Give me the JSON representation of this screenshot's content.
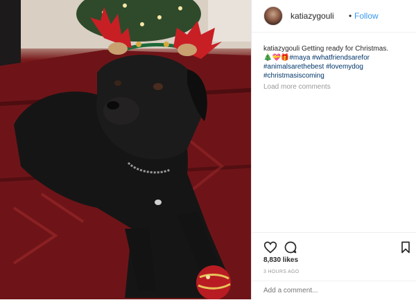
{
  "header": {
    "username": "katiazygouli",
    "separator": "•",
    "follow_label": "Follow"
  },
  "caption": {
    "username": "katiazygouli",
    "text": "Getting ready for Christmas.",
    "emoji": "🎄💝🎁",
    "hashtags": [
      "#maya",
      "#whatfriendsarefor",
      "#animalsarethebest",
      "#lovemydog",
      "#christmasiscoming"
    ]
  },
  "comments": {
    "load_more_label": "Load more comments"
  },
  "actions": {
    "icons": [
      "heart-icon",
      "comment-icon",
      "bookmark-icon"
    ],
    "likes": "8,830 likes",
    "timestamp": "3 HOURS AGO"
  },
  "comment_box": {
    "placeholder": "Add a comment..."
  },
  "colors": {
    "link": "#3897f0",
    "hashtag": "#003569",
    "muted": "#999999",
    "rug_red": "#7a1a1c"
  }
}
